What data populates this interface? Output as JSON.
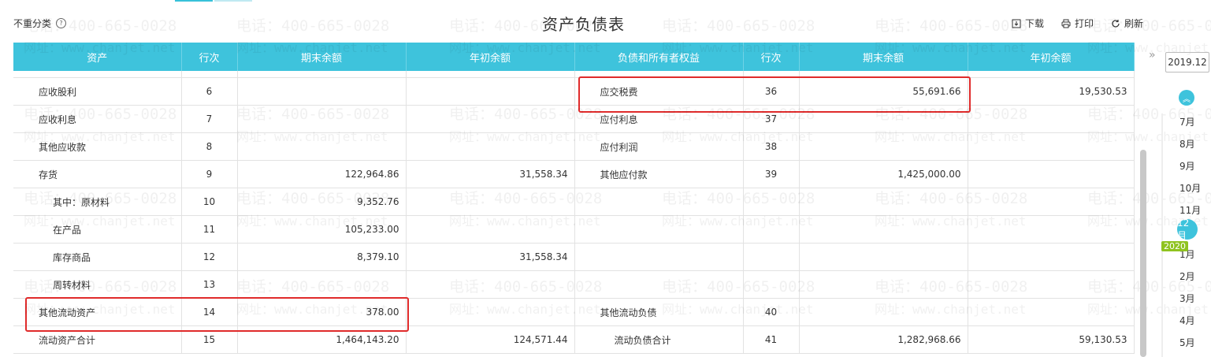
{
  "topbar": {
    "filter_label": "不重分类",
    "help_icon": "?",
    "title": "资产负债表",
    "actions": [
      {
        "label": "下载",
        "icon": "download-icon"
      },
      {
        "label": "打印",
        "icon": "print-icon"
      },
      {
        "label": "刷新",
        "icon": "refresh-icon"
      }
    ]
  },
  "table": {
    "headers": [
      "资产",
      "行次",
      "期末余额",
      "年初余额",
      "负债和所有者权益",
      "行次",
      "期末余额",
      "年初余额"
    ],
    "rows": [
      {
        "a_name": "应收股利",
        "a_line": "6",
        "a_end": "",
        "a_begin": "",
        "l_name": "应交税费",
        "l_line": "36",
        "l_end": "55,691.66",
        "l_begin": "19,530.53"
      },
      {
        "a_name": "应收利息",
        "a_line": "7",
        "a_end": "",
        "a_begin": "",
        "l_name": "应付利息",
        "l_line": "37",
        "l_end": "",
        "l_begin": ""
      },
      {
        "a_name": "其他应收款",
        "a_line": "8",
        "a_end": "",
        "a_begin": "",
        "l_name": "应付利润",
        "l_line": "38",
        "l_end": "",
        "l_begin": ""
      },
      {
        "a_name": "存货",
        "a_line": "9",
        "a_end": "122,964.86",
        "a_begin": "31,558.34",
        "l_name": "其他应付款",
        "l_line": "39",
        "l_end": "1,425,000.00",
        "l_begin": ""
      },
      {
        "a_name": "其中：原材料",
        "a_line": "10",
        "a_end": "9,352.76",
        "a_begin": "",
        "l_name": "",
        "l_line": "",
        "l_end": "",
        "l_begin": ""
      },
      {
        "a_name": "在产品",
        "a_line": "11",
        "a_end": "105,233.00",
        "a_begin": "",
        "l_name": "",
        "l_line": "",
        "l_end": "",
        "l_begin": ""
      },
      {
        "a_name": "库存商品",
        "a_line": "12",
        "a_end": "8,379.10",
        "a_begin": "31,558.34",
        "l_name": "",
        "l_line": "",
        "l_end": "",
        "l_begin": ""
      },
      {
        "a_name": "周转材料",
        "a_line": "13",
        "a_end": "",
        "a_begin": "",
        "l_name": "",
        "l_line": "",
        "l_end": "",
        "l_begin": ""
      },
      {
        "a_name": "其他流动资产",
        "a_line": "14",
        "a_end": "378.00",
        "a_begin": "",
        "l_name": "其他流动负债",
        "l_line": "40",
        "l_end": "",
        "l_begin": ""
      },
      {
        "a_name": "流动资产合计",
        "a_line": "15",
        "a_end": "1,464,143.20",
        "a_begin": "124,571.44",
        "l_name": "流动负债合计",
        "l_line": "41",
        "l_end": "1,282,968.66",
        "l_begin": "59,130.53"
      }
    ]
  },
  "watermark": {
    "phone": "电话：400-665-0028",
    "site": "网址：www.chanjet.net"
  },
  "period": {
    "selected": "2019.12",
    "months": [
      "7月",
      "8月",
      "9月",
      "10月",
      "11月",
      "12月",
      "1月",
      "2月",
      "3月",
      "4月",
      "5月"
    ],
    "active_month": "12月",
    "year_badge": "2020"
  },
  "colors": {
    "header_bg": "#3ec3dc",
    "highlight": "#e02b2b",
    "year_badge": "#8fc31f"
  }
}
